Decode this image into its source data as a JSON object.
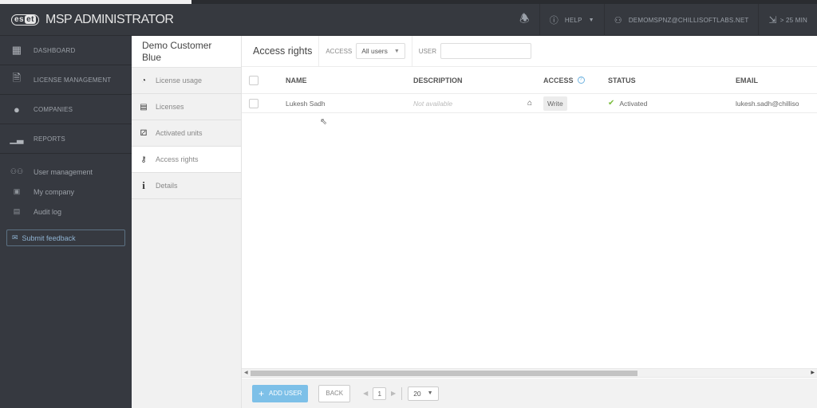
{
  "header": {
    "logo_badge_left": "es",
    "logo_badge_right": "et",
    "app_title": "MSP ADMINISTRATOR",
    "help_label": "HELP",
    "user_email": "DEMOMSPNZ@CHILLISOFTLABS.NET",
    "session_label": "> 25 MIN"
  },
  "sidebar": {
    "main_items": [
      {
        "label": "DASHBOARD",
        "icon": "grid-icon"
      },
      {
        "label": "LICENSE MANAGEMENT",
        "icon": "license-icon"
      },
      {
        "label": "COMPANIES",
        "icon": "globe-icon"
      },
      {
        "label": "REPORTS",
        "icon": "chart-icon"
      }
    ],
    "sub_items": [
      {
        "label": "User management",
        "icon": "users-icon"
      },
      {
        "label": "My company",
        "icon": "briefcase-icon"
      },
      {
        "label": "Audit log",
        "icon": "clipboard-icon"
      }
    ],
    "feedback_label": "Submit feedback"
  },
  "customer": {
    "name": "Demo Customer Blue",
    "items": [
      {
        "label": "License usage",
        "icon": "clock-icon",
        "active": false
      },
      {
        "label": "Licenses",
        "icon": "license-icon",
        "active": false
      },
      {
        "label": "Activated units",
        "icon": "network-icon",
        "active": false
      },
      {
        "label": "Access rights",
        "icon": "key-icon",
        "active": true
      },
      {
        "label": "Details",
        "icon": "info-icon",
        "active": false
      }
    ]
  },
  "toolbar": {
    "title": "Access rights",
    "access_label": "ACCESS",
    "access_value": "All users",
    "user_label": "USER",
    "user_value": ""
  },
  "table": {
    "columns": [
      "NAME",
      "DESCRIPTION",
      "ACCESS",
      "STATUS",
      "EMAIL"
    ],
    "rows": [
      {
        "name": "Lukesh Sadh",
        "description": "Not available",
        "access": "Write",
        "status": "Activated",
        "email": "lukesh.sadh@chilliso"
      }
    ]
  },
  "footer": {
    "add_user_label": "ADD USER",
    "back_label": "BACK",
    "page": "1",
    "per_page": "20"
  },
  "scrollbar": {
    "visible_fraction": 0.68,
    "position": 0
  }
}
